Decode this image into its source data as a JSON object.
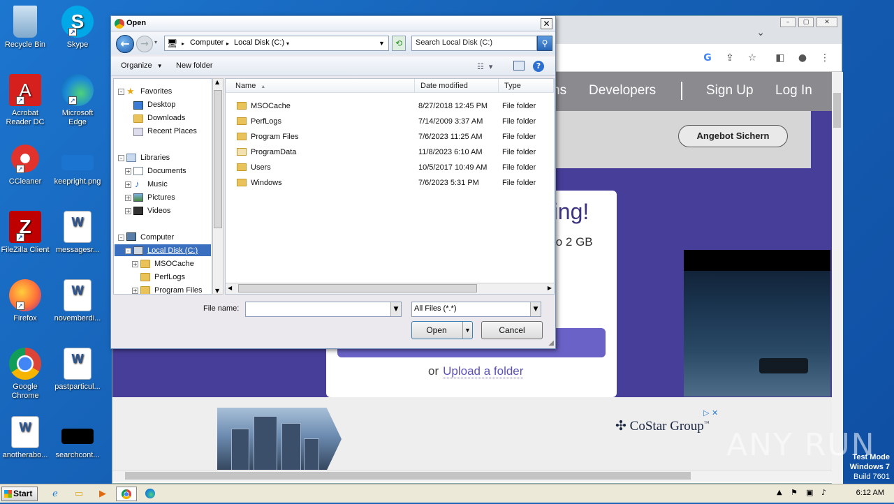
{
  "desktop_icons": [
    {
      "label": "Recycle Bin",
      "icon": "recycle-bin-icon"
    },
    {
      "label": "Skype",
      "icon": "skype-icon"
    },
    {
      "label": "Acrobat Reader DC",
      "icon": "acrobat-icon"
    },
    {
      "label": "Microsoft Edge",
      "icon": "edge-icon"
    },
    {
      "label": "CCleaner",
      "icon": "ccleaner-icon"
    },
    {
      "label": "keepright.png",
      "icon": "image-file-icon"
    },
    {
      "label": "FileZilla Client",
      "icon": "filezilla-icon"
    },
    {
      "label": "messagesr...",
      "icon": "word-doc-icon"
    },
    {
      "label": "Firefox",
      "icon": "firefox-icon"
    },
    {
      "label": "novemberdi...",
      "icon": "word-doc-icon"
    },
    {
      "label": "Google Chrome",
      "icon": "chrome-icon"
    },
    {
      "label": "pastparticul...",
      "icon": "word-doc-icon"
    },
    {
      "label": "anotherabo...",
      "icon": "word-doc-icon"
    },
    {
      "label": "searchcont...",
      "icon": "black-file-icon"
    }
  ],
  "website": {
    "nav": [
      "ns",
      "Developers",
      "Sign Up",
      "Log In"
    ],
    "angebot_button": "Angebot Sichern",
    "hero_title_fragment": "ring!",
    "hero_subtitle_fragment": "to 2 GB",
    "or_text": "or",
    "upload_folder_link": "Upload a folder",
    "ad_brand": "CoStar Group",
    "ad_brand_mark": "™"
  },
  "dialog": {
    "title": "Open",
    "breadcrumb": [
      "Computer",
      "Local Disk (C:)"
    ],
    "search_placeholder": "Search Local Disk (C:)",
    "organize_label": "Organize",
    "new_folder_label": "New folder",
    "nav_tree": {
      "favorites": "Favorites",
      "favorites_items": [
        "Desktop",
        "Downloads",
        "Recent Places"
      ],
      "libraries": "Libraries",
      "libraries_items": [
        "Documents",
        "Music",
        "Pictures",
        "Videos"
      ],
      "computer": "Computer",
      "selected_drive": "Local Disk (C:)",
      "drive_children": [
        "MSOCache",
        "PerfLogs",
        "Program Files"
      ]
    },
    "columns": [
      "Name",
      "Date modified",
      "Type"
    ],
    "files": [
      {
        "name": "MSOCache",
        "date": "8/27/2018 12:45 PM",
        "type": "File folder"
      },
      {
        "name": "PerfLogs",
        "date": "7/14/2009 3:37 AM",
        "type": "File folder"
      },
      {
        "name": "Program Files",
        "date": "7/6/2023 11:25 AM",
        "type": "File folder"
      },
      {
        "name": "ProgramData",
        "date": "11/8/2023 6:10 AM",
        "type": "File folder"
      },
      {
        "name": "Users",
        "date": "10/5/2017 10:49 AM",
        "type": "File folder"
      },
      {
        "name": "Windows",
        "date": "7/6/2023 5:31 PM",
        "type": "File folder"
      }
    ],
    "file_name_label": "File name:",
    "file_name_value": "",
    "file_type_value": "All Files (*.*)",
    "open_label": "Open",
    "cancel_label": "Cancel"
  },
  "taskbar": {
    "start_label": "Start",
    "time": "6:12 AM"
  },
  "watermark": {
    "text": "ANY RUN",
    "test_mode": [
      "Test Mode",
      "Windows 7",
      "Build 7601"
    ]
  }
}
